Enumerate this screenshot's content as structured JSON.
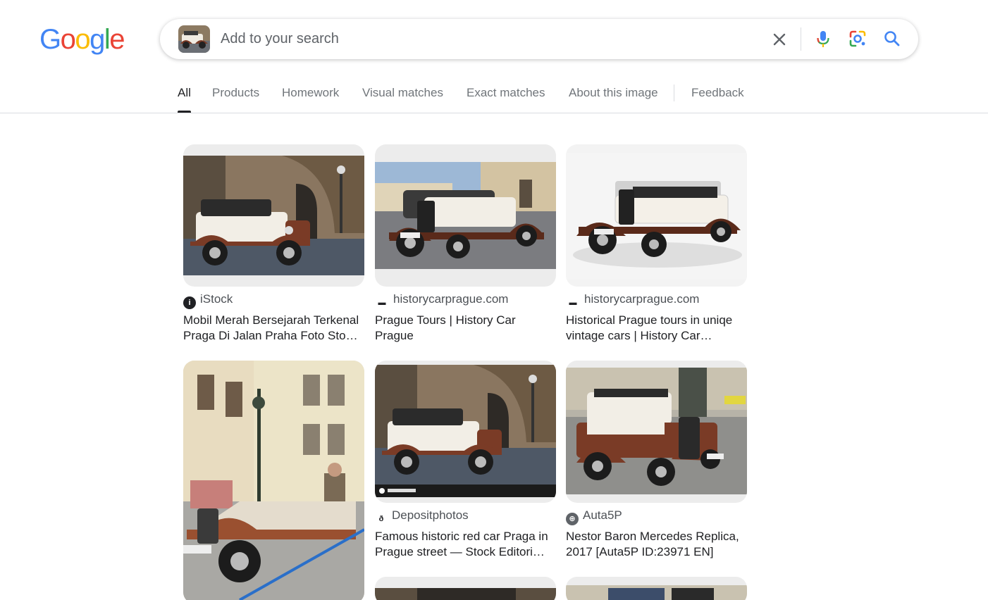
{
  "logo": {
    "text": "Google",
    "letters": [
      "G",
      "o",
      "o",
      "g",
      "l",
      "e"
    ],
    "colors": [
      "#4285F4",
      "#EA4335",
      "#FBBC05",
      "#4285F4",
      "#34A853",
      "#EA4335"
    ]
  },
  "search": {
    "placeholder": "Add to your search",
    "value": "",
    "thumb_icon": "car-thumbnail"
  },
  "tabs": [
    {
      "label": "All",
      "active": true
    },
    {
      "label": "Products"
    },
    {
      "label": "Homework"
    },
    {
      "label": "Visual matches"
    },
    {
      "label": "Exact matches"
    },
    {
      "label": "About this image"
    },
    {
      "label": "Feedback"
    }
  ],
  "results": [
    {
      "source": "iStock",
      "icon": "istock-icon",
      "title": "Mobil Merah Bersejarah Terkenal Praga Di Jalan Praha Foto Sto…"
    },
    {
      "source": "historycarprague.com",
      "icon": "car-favicon",
      "title": "Prague Tours | History Car Prague"
    },
    {
      "source": "historycarprague.com",
      "icon": "car-favicon",
      "title": "Historical Prague tours in uniqe vintage cars | History Car…"
    },
    {
      "source": "",
      "icon": "",
      "title": ""
    },
    {
      "source": "Depositphotos",
      "icon": "depositphotos-icon",
      "title": "Famous historic red car Praga in Prague street — Stock Editori…"
    },
    {
      "source": "Auta5P",
      "icon": "auta5p-icon",
      "title": "Nestor Baron Mercedes Replica, 2017 [Auta5P ID:23971 EN]"
    }
  ],
  "colors": {
    "accent": "#1a73e8",
    "tab_active": "#202124",
    "car_body": "#7a3b26",
    "car_cream": "#f1ede4"
  }
}
